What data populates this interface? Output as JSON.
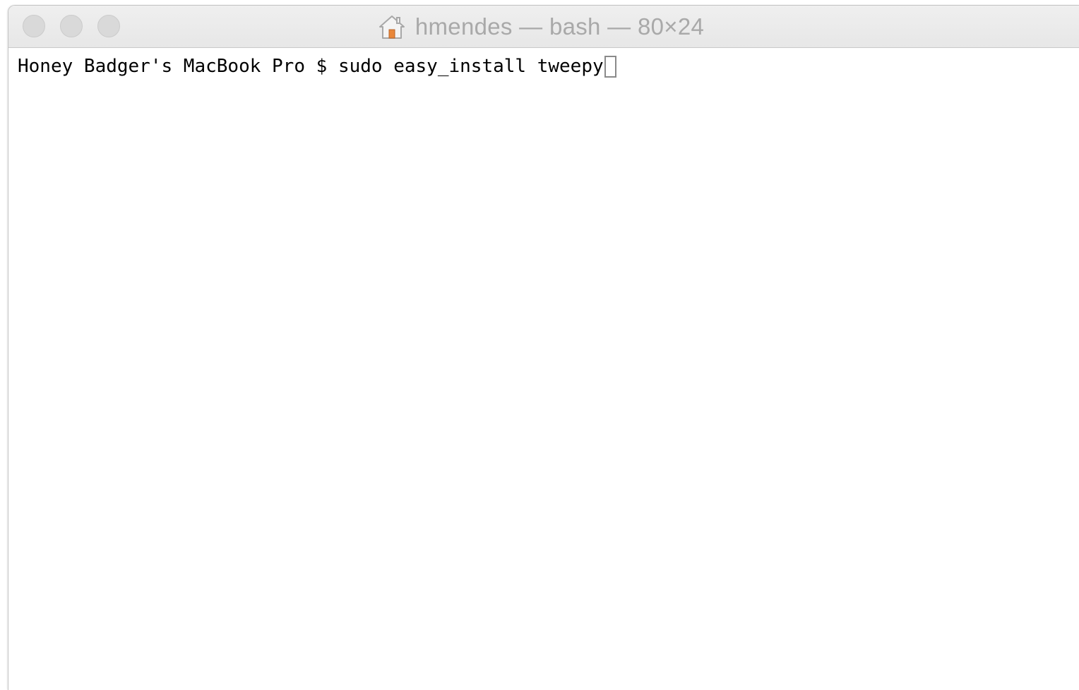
{
  "window": {
    "title": "hmendes — bash — 80×24",
    "title_icon": "home-icon",
    "buttons": [
      "close",
      "minimize",
      "zoom"
    ]
  },
  "terminal": {
    "prompt": "Honey Badger's MacBook Pro $ ",
    "command": "sudo easy_install tweepy",
    "cursor": "block-cursor"
  },
  "colors": {
    "title_text": "#a9a9a9",
    "titlebar_bg": "#ececec",
    "traffic_light": "#d9d9d9",
    "terminal_bg": "#ffffff",
    "terminal_text": "#000000",
    "home_icon": "#e9873a"
  }
}
